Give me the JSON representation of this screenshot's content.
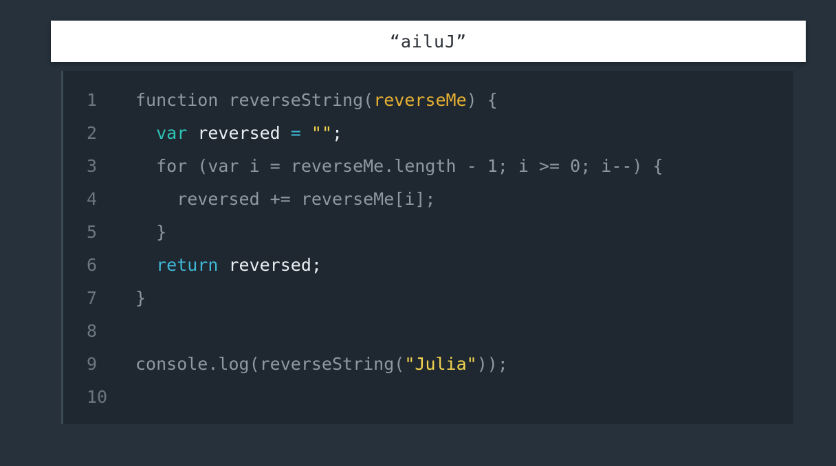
{
  "output": {
    "text": "“ailuJ”"
  },
  "editor": {
    "lines": [
      {
        "number": "1",
        "tokens": [
          {
            "text": "function ",
            "kind": "plain"
          },
          {
            "text": "reverseString(",
            "kind": "plain"
          },
          {
            "text": "reverseMe",
            "kind": "param"
          },
          {
            "text": ") {",
            "kind": "plain"
          }
        ]
      },
      {
        "number": "2",
        "tokens": [
          {
            "text": "  ",
            "kind": "plain"
          },
          {
            "text": "var",
            "kind": "var"
          },
          {
            "text": " reversed ",
            "kind": "ident"
          },
          {
            "text": "= ",
            "kind": "kw"
          },
          {
            "text": "\"\"",
            "kind": "string"
          },
          {
            "text": ";",
            "kind": "ident"
          }
        ]
      },
      {
        "number": "3",
        "tokens": [
          {
            "text": "  for (var i = reverseMe.length - 1; i >= 0; i--) {",
            "kind": "plain"
          }
        ]
      },
      {
        "number": "4",
        "tokens": [
          {
            "text": "    reversed += reverseMe[i];",
            "kind": "plain"
          }
        ]
      },
      {
        "number": "5",
        "tokens": [
          {
            "text": "  }",
            "kind": "plain"
          }
        ]
      },
      {
        "number": "6",
        "tokens": [
          {
            "text": "  ",
            "kind": "plain"
          },
          {
            "text": "return",
            "kind": "kw"
          },
          {
            "text": " reversed;",
            "kind": "ident"
          }
        ]
      },
      {
        "number": "7",
        "tokens": [
          {
            "text": "}",
            "kind": "plain"
          }
        ]
      },
      {
        "number": "8",
        "tokens": []
      },
      {
        "number": "9",
        "tokens": [
          {
            "text": "console.log(reverseString(",
            "kind": "plain"
          },
          {
            "text": "\"Julia\"",
            "kind": "string"
          },
          {
            "text": "));",
            "kind": "plain"
          }
        ]
      },
      {
        "number": "10",
        "tokens": []
      }
    ]
  },
  "colors": {
    "background": "#26313b",
    "editor_background": "#1f2830",
    "keyword": "#3fb7d6",
    "var_keyword": "#2ec4b6",
    "parameter": "#e6b032",
    "string": "#f2d24e",
    "plain": "#8e98a1",
    "line_number": "#6b7680"
  }
}
